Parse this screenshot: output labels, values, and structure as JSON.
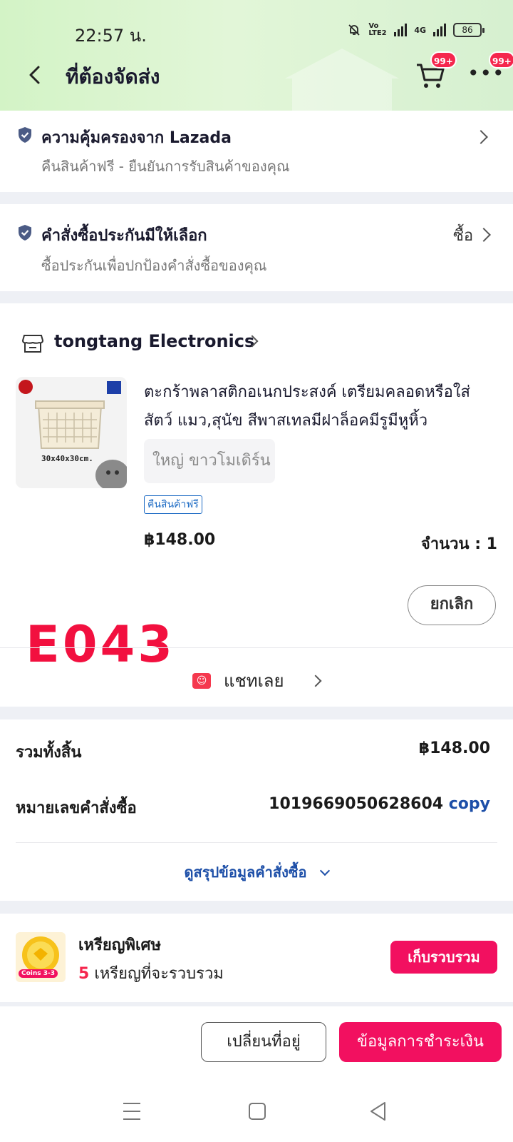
{
  "status_bar": {
    "time": "22:57 น.",
    "battery": "86",
    "network_4g": "4G",
    "volte": "Vo LTE2"
  },
  "header": {
    "title": "ที่ต้องจัดส่ง",
    "cart_badge": "99+",
    "menu_badge": "99+"
  },
  "protection": {
    "title": "ความคุ้มครองจาก Lazada",
    "subtitle": "คืนสินค้าฟรี - ยืนยันการรับสินค้าของคุณ"
  },
  "insurance": {
    "title": "คำสั่งซื้อประกันมีให้เลือก",
    "subtitle": "ซื้อประกันเพื่อปกป้องคำสั่งซื้อของคุณ",
    "action": "ซื้อ"
  },
  "shop": {
    "name": "tongtang Electronics",
    "product": {
      "title_line1": "ตะกร้าพลาสติกอเนกประสงค์ เตรียมคลอดหรือใส่",
      "title_line2": "สัตว์ แมว,สุนัข สีพาสเทลมีฝาล็อคมีรูมีหูหิ้ว",
      "image_caption": "30x40x30cm.",
      "variant": "ใหญ่ ขาวโมเดิร์น",
      "tag": "คืนสินค้าฟรี",
      "price": "฿148.00",
      "quantity": "จำนวน : 1"
    },
    "cancel_label": "ยกเลิก",
    "chat_label": "แชทเลย"
  },
  "watermark": "E043",
  "summary": {
    "total_label": "รวมทั้งสิ้น",
    "total_value": "฿148.00",
    "order_label": "หมายเลขคำสั่งซื้อ",
    "order_number": "1019669050628604",
    "copy_label": "copy",
    "details_link": "ดูสรุปข้อมูลคำสั่งซื้อ"
  },
  "coins": {
    "badge": "Coins 3-3",
    "title": "เหรียญพิเศษ",
    "count": "5",
    "subtitle": "เหรียญที่จะรวบรวม",
    "button": "เก็บรวบรวม"
  },
  "footer": {
    "change_address": "เปลี่ยนที่อยู่",
    "payment_info": "ข้อมูลการชำระเงิน"
  },
  "colors": {
    "accent": "#f21060",
    "link": "#1d4fa8",
    "header_green": "#d3f3c6"
  }
}
